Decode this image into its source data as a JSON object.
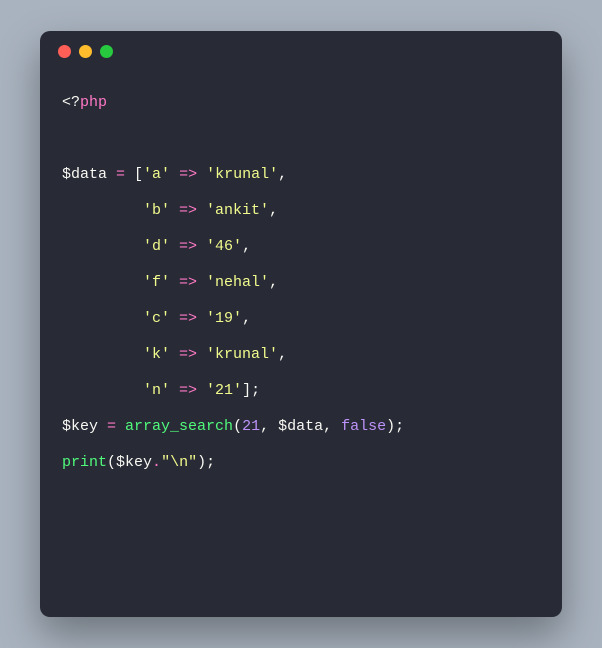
{
  "colors": {
    "background_page": "#a9b3bf",
    "background_window": "#282a36",
    "dot_red": "#ff5f56",
    "dot_yellow": "#ffbd2e",
    "dot_green": "#27c93f",
    "text_default": "#f8f8f2",
    "text_keyword": "#ff79c6",
    "text_string": "#f1fa8c",
    "text_number": "#bd93f9",
    "text_function": "#50fa7b"
  },
  "code": {
    "open_tag_lt": "<?",
    "open_tag_word": "php",
    "var_data": "$data",
    "assign": " = ",
    "lbracket": "[",
    "arrow": " => ",
    "comma": ",",
    "entries": [
      {
        "key": "'a'",
        "value": "'krunal'"
      },
      {
        "key": "'b'",
        "value": "'ankit'"
      },
      {
        "key": "'d'",
        "value": "'46'"
      },
      {
        "key": "'f'",
        "value": "'nehal'"
      },
      {
        "key": "'c'",
        "value": "'19'"
      },
      {
        "key": "'k'",
        "value": "'krunal'"
      },
      {
        "key": "'n'",
        "value": "'21'"
      }
    ],
    "rbracket_semi": "];",
    "var_key": "$key",
    "func_array_search": "array_search",
    "lparen": "(",
    "arg_num": "21",
    "arg_sep": ", ",
    "arg_data": "$data",
    "arg_false": "false",
    "rparen_semi": ");",
    "func_print": "print",
    "concat_dot": ".",
    "newline_str": "\"\\n\"",
    "indent": "         "
  }
}
